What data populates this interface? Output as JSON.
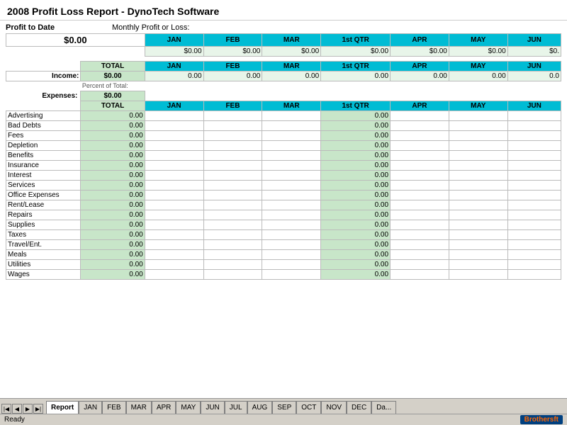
{
  "title": "2008 Profit Loss Report - DynoTech Software",
  "profit_to_date_label": "Profit to Date",
  "monthly_profit_label": "Monthly Profit or Loss:",
  "profit_value": "$0.00",
  "columns": {
    "total": "TOTAL",
    "jan": "JAN",
    "feb": "FEB",
    "mar": "MAR",
    "qtr1": "1st QTR",
    "apr": "APR",
    "may": "MAY",
    "jun": "JUN"
  },
  "monthly_values": [
    "$0.00",
    "$0.00",
    "$0.00",
    "$0.00",
    "$0.00",
    "$0.00",
    "$0."
  ],
  "income_label": "Income:",
  "income_total": "$0.00",
  "income_values": [
    "0.00",
    "0.00",
    "0.00",
    "0.00",
    "0.00",
    "0.00",
    "0.0"
  ],
  "percent_of_total": "Percent of Total:",
  "expenses_label": "Expenses:",
  "expenses_total": "$0.00",
  "expense_rows": [
    {
      "label": "Advertising",
      "total": "0.00",
      "qtr": "0.00"
    },
    {
      "label": "Bad Debts",
      "total": "0.00",
      "qtr": "0.00"
    },
    {
      "label": "Fees",
      "total": "0.00",
      "qtr": "0.00"
    },
    {
      "label": "Depletion",
      "total": "0.00",
      "qtr": "0.00"
    },
    {
      "label": "Benefits",
      "total": "0.00",
      "qtr": "0.00"
    },
    {
      "label": "Insurance",
      "total": "0.00",
      "qtr": "0.00"
    },
    {
      "label": "Interest",
      "total": "0.00",
      "qtr": "0.00"
    },
    {
      "label": "Services",
      "total": "0.00",
      "qtr": "0.00"
    },
    {
      "label": "Office Expenses",
      "total": "0.00",
      "qtr": "0.00"
    },
    {
      "label": "Rent/Lease",
      "total": "0.00",
      "qtr": "0.00"
    },
    {
      "label": "Repairs",
      "total": "0.00",
      "qtr": "0.00"
    },
    {
      "label": "Supplies",
      "total": "0.00",
      "qtr": "0.00"
    },
    {
      "label": "Taxes",
      "total": "0.00",
      "qtr": "0.00"
    },
    {
      "label": "Travel/Ent.",
      "total": "0.00",
      "qtr": "0.00"
    },
    {
      "label": "Meals",
      "total": "0.00",
      "qtr": "0.00"
    },
    {
      "label": "Utilities",
      "total": "0.00",
      "qtr": "0.00"
    },
    {
      "label": "Wages",
      "total": "0.00",
      "qtr": "0.00"
    }
  ],
  "tabs": [
    "Report",
    "JAN",
    "FEB",
    "MAR",
    "APR",
    "MAY",
    "JUN",
    "JUL",
    "AUG",
    "SEP",
    "OCT",
    "NOV",
    "DEC",
    "Da..."
  ],
  "status": "Ready",
  "logo_text": "Brothers",
  "logo_suffix": "ft"
}
